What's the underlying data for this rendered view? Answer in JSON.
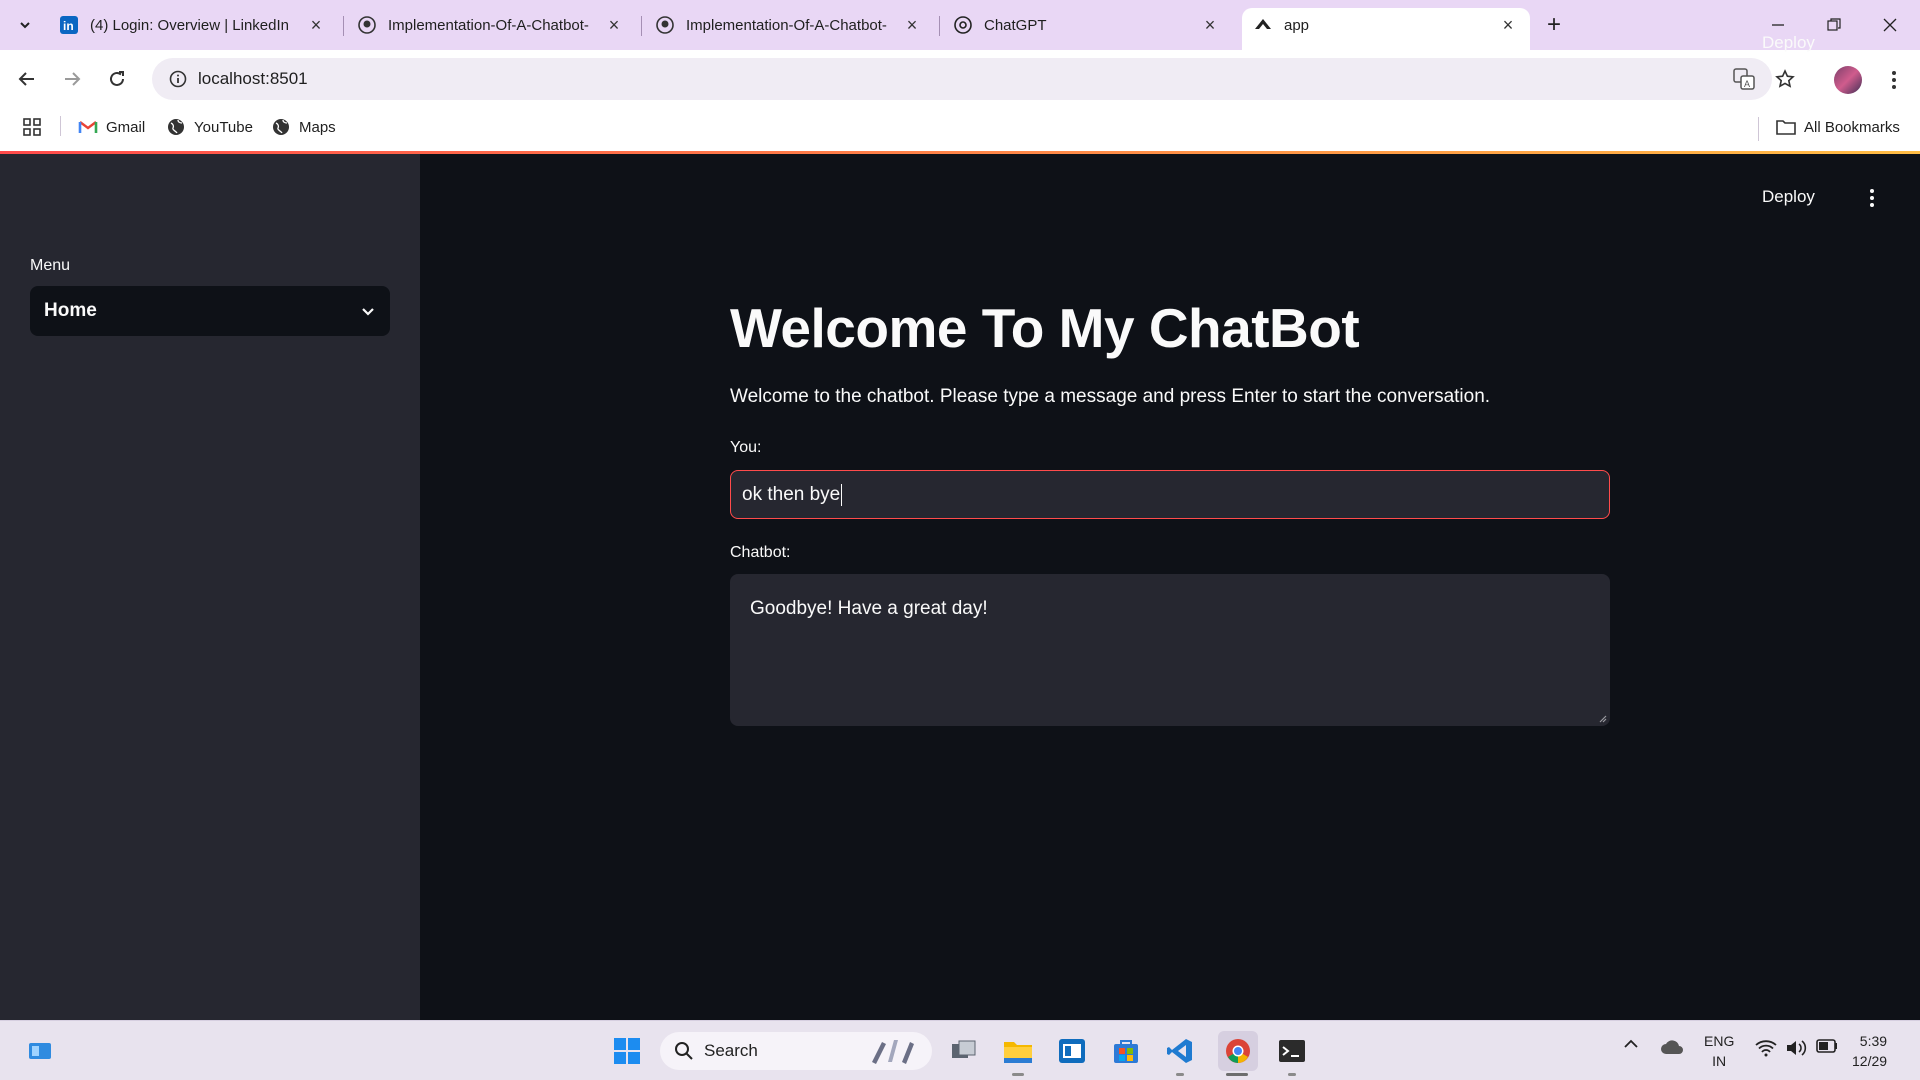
{
  "browser": {
    "tabs": [
      {
        "title": "(4) Login: Overview | LinkedIn",
        "icon": "linkedin-icon"
      },
      {
        "title": "Implementation-Of-A-Chatbot-",
        "icon": "github-icon"
      },
      {
        "title": "Implementation-Of-A-Chatbot-",
        "icon": "github-icon"
      },
      {
        "title": "ChatGPT",
        "icon": "openai-icon"
      },
      {
        "title": "app",
        "icon": "streamlit-icon",
        "active": true
      }
    ],
    "url": "localhost:8501",
    "bookmarks": [
      {
        "label": "Gmail",
        "icon": "gmail-icon"
      },
      {
        "label": "YouTube",
        "icon": "globe-icon"
      },
      {
        "label": "Maps",
        "icon": "globe-icon"
      }
    ],
    "all_bookmarks": "All Bookmarks"
  },
  "sidebar": {
    "menu_label": "Menu",
    "select_value": "Home"
  },
  "header": {
    "deploy": "Deploy"
  },
  "main": {
    "title": "Welcome To My ChatBot",
    "intro": "Welcome to the chatbot. Please type a message and press Enter to start the conversation.",
    "you_label": "You:",
    "you_value": "ok then bye",
    "chatbot_label": "Chatbot:",
    "chatbot_value": "Goodbye! Have a great day!"
  },
  "taskbar": {
    "search": "Search",
    "lang_line1": "ENG",
    "lang_line2": "IN",
    "time": "5:39",
    "date": "12/29"
  },
  "colors": {
    "accent": "#ff4b4b",
    "sidebar_bg": "#262730",
    "main_bg": "#0e1117",
    "tabbar_bg": "#e9d7f5"
  }
}
